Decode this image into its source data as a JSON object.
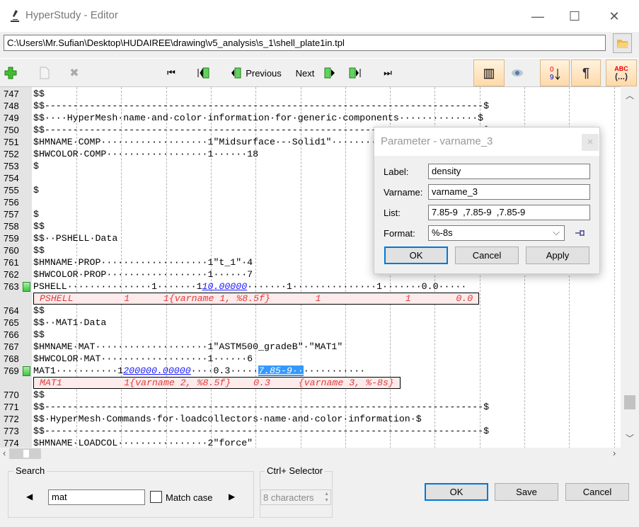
{
  "window": {
    "title": "HyperStudy - Editor",
    "app_icon": "microscope-icon",
    "controls": {
      "minimize": "—",
      "maximize": "☐",
      "close": "✕"
    }
  },
  "path": {
    "value": "C:\\Users\\Mr.Sufian\\Desktop\\HUDAIREE\\drawing\\v5_analysis\\s_1\\shell_plate1in.tpl",
    "browse_icon": "folder-icon"
  },
  "toolbar": {
    "add_icon": "plus-icon",
    "new_icon": "document-icon",
    "delete_icon": "delete-x-icon",
    "first": "⏮",
    "previous_marker": "◀▮",
    "previous_label": "Previous",
    "next_label": "Next",
    "next_marker": "▮▶",
    "last_marker": "▮⏭",
    "last": "⏭",
    "columns_icon": "▥",
    "view_icon": "eye-icon",
    "sort_icon": "0-9 sort",
    "pilcrow": "¶",
    "abc_top": "ABC",
    "abc_bottom": "(...)"
  },
  "editor": {
    "lines": [
      {
        "n": "747",
        "parts": [
          {
            "t": "$$"
          }
        ]
      },
      {
        "n": "748",
        "parts": [
          {
            "t": "$$------------------------------------------------------------------------------$"
          }
        ]
      },
      {
        "n": "749",
        "parts": [
          {
            "t": "$$····HyperMesh·name·and·color·information·for·generic·components··············$"
          }
        ]
      },
      {
        "n": "750",
        "parts": [
          {
            "t": "$$------------------------------------------------------------------------------$"
          }
        ]
      },
      {
        "n": "751",
        "parts": [
          {
            "t": "$HMNAME·COMP···················1\"Midsurface·-·Solid1\"···········"
          }
        ]
      },
      {
        "n": "752",
        "parts": [
          {
            "t": "$HWCOLOR·COMP··················1······18"
          }
        ]
      },
      {
        "n": "753",
        "parts": [
          {
            "t": "$"
          }
        ]
      },
      {
        "n": "754",
        "parts": [
          {
            "t": ""
          }
        ]
      },
      {
        "n": "755",
        "parts": [
          {
            "t": "$"
          }
        ]
      },
      {
        "n": "756",
        "parts": [
          {
            "t": ""
          }
        ]
      },
      {
        "n": "757",
        "parts": [
          {
            "t": "$"
          }
        ]
      },
      {
        "n": "758",
        "parts": [
          {
            "t": "$$"
          }
        ]
      },
      {
        "n": "759",
        "parts": [
          {
            "t": "$$··PSHELL·Data"
          }
        ]
      },
      {
        "n": "760",
        "parts": [
          {
            "t": "$$"
          }
        ]
      },
      {
        "n": "761",
        "parts": [
          {
            "t": "$HMNAME·PROP···················1\"t_1\"·4"
          }
        ]
      },
      {
        "n": "762",
        "parts": [
          {
            "t": "$HWCOLOR·PROP··················1······7"
          }
        ]
      },
      {
        "n": "763",
        "marker": true,
        "parts": [
          {
            "t": "PSHELL···············1·······1"
          },
          {
            "t": "10.00000",
            "cls": "u"
          },
          {
            "t": "·······1···············1·······0.0·····"
          }
        ]
      },
      {
        "template": " PSHELL         1      1{varname 1, %8.5f}        1               1        0.0 "
      },
      {
        "n": "764",
        "parts": [
          {
            "t": "$$"
          }
        ]
      },
      {
        "n": "765",
        "parts": [
          {
            "t": "$$··MAT1·Data"
          }
        ]
      },
      {
        "n": "766",
        "parts": [
          {
            "t": "$$"
          }
        ]
      },
      {
        "n": "767",
        "parts": [
          {
            "t": "$HMNAME·MAT····················1\"ASTM500_gradeB\"·\"MAT1\""
          }
        ]
      },
      {
        "n": "768",
        "parts": [
          {
            "t": "$HWCOLOR·MAT···················1······6"
          }
        ]
      },
      {
        "n": "769",
        "marker": true,
        "parts": [
          {
            "t": "MAT1···········1"
          },
          {
            "t": "200000.00000",
            "cls": "u"
          },
          {
            "t": "····0.3·····"
          },
          {
            "t": "7.85-9··",
            "cls": "sel"
          },
          {
            "t": "···········"
          }
        ]
      },
      {
        "template": " MAT1           1{varname 2, %8.5f}    0.3     {varname 3, %-8s} "
      },
      {
        "n": "770",
        "parts": [
          {
            "t": "$$"
          }
        ]
      },
      {
        "n": "771",
        "parts": [
          {
            "t": "$$------------------------------------------------------------------------------$"
          }
        ]
      },
      {
        "n": "772",
        "parts": [
          {
            "t": "$$·HyperMesh·Commands·for·loadcollectors·name·and·color·information·$"
          }
        ]
      },
      {
        "n": "773",
        "parts": [
          {
            "t": "$$------------------------------------------------------------------------------$"
          }
        ]
      },
      {
        "n": "774",
        "parts": [
          {
            "t": "$HMNAME·LOADCOL················2\"force\""
          }
        ]
      }
    ]
  },
  "dialog": {
    "title": "Parameter - varname_3",
    "close": "×",
    "label_label": "Label:",
    "label_value": "density",
    "varname_label": "Varname:",
    "varname_value": "varname_3",
    "list_label": "List:",
    "list_value": "7.85-9  ,7.85-9  ,7.85-9",
    "format_label": "Format:",
    "format_value": "%-8s",
    "pin_icon": "pin-icon",
    "ok": "OK",
    "cancel": "Cancel",
    "apply": "Apply"
  },
  "search": {
    "group_label": "Search",
    "prev": "◀",
    "value": "mat",
    "match_case_label": "Match case",
    "match_case_checked": false,
    "next": "▶"
  },
  "selector": {
    "group_label": "Ctrl+ Selector",
    "value": "8 characters"
  },
  "footer": {
    "ok": "OK",
    "save": "Save",
    "cancel": "Cancel"
  },
  "colors": {
    "accent": "#0078d7",
    "template_text": "#e03c3c",
    "template_bg": "#fdeaea",
    "selection": "#3399ff",
    "marker": "#3cc83c",
    "toolbar_toggle": "#ffd9a8"
  }
}
